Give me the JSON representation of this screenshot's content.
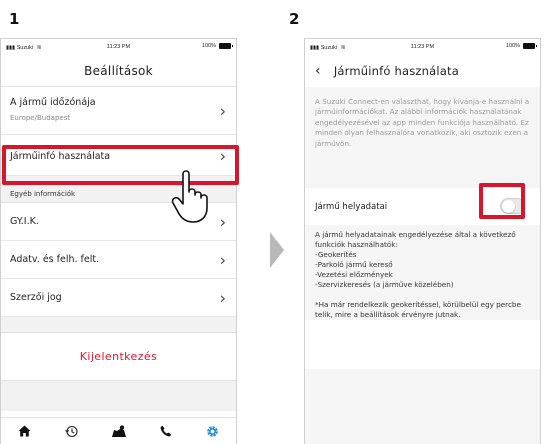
{
  "steps": {
    "one": "1",
    "two": "2"
  },
  "status": {
    "carrier": "Suzuki",
    "time": "11:23 PM",
    "battery": "100%"
  },
  "screen1": {
    "title": "Beállítások",
    "timezone": {
      "label": "A jármű időzónája",
      "value": "Europe/Budapest"
    },
    "vehicle_info": {
      "label": "Járműinfó használata"
    },
    "section_header": "Egyéb információk",
    "faq": "GY.I.K.",
    "privacy": "Adatv. és felh. felt.",
    "copyright": "Szerzői jog",
    "logout": "Kijelentkezés",
    "tabs": [
      "home-icon",
      "history-icon",
      "map-icon",
      "phone-icon",
      "settings-icon"
    ]
  },
  "screen2": {
    "title": "Járműinfó használata",
    "description": "A Suzuki Connect-en választhat, hogy kívánja-e használni a járműinformációkat. Az alábbi információk használatának engedélyezésével az app minden funkciója használható. Ez minden olyan felhasználóra vonatkozik, aki osztozik ezen a járművön.",
    "location_label": "Jármű helyadatai",
    "location_enabled": false,
    "features_intro": "A jármű helyadatainak engedélyezése által a következő funkciók használhatók:",
    "features": [
      "-Geokerítés",
      "-Parkoló jármű kereső",
      "-Vezetési előzmények",
      "-Szervizkeresés (a járműve közelében)"
    ],
    "note": "*Ha már rendelkezik geokerítéssel, körülbelül egy percbe telik, mire a beállítások érvényre jutnak."
  },
  "colors": {
    "accent_red": "#d6162c",
    "logout_red": "#e0142d",
    "settings_blue": "#1a8ad9",
    "arrow_gray": "#b8b8b8"
  }
}
